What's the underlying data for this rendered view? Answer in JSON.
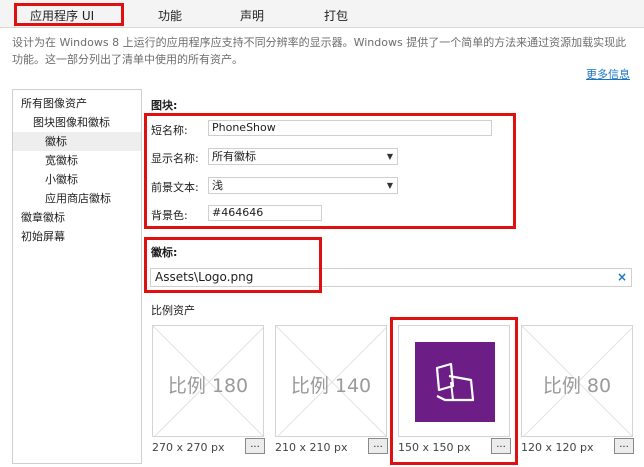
{
  "tabs": [
    {
      "label": "应用程序 UI"
    },
    {
      "label": "功能"
    },
    {
      "label": "声明"
    },
    {
      "label": "打包"
    }
  ],
  "description": "设计为在 Windows 8 上运行的应用程序应支持不同分辨率的显示器。Windows 提供了一个简单的方法来通过资源加载实现此功能。这一部分列出了清单中使用的所有资产。",
  "more_info": "更多信息",
  "nav": {
    "items": [
      {
        "label": "所有图像资产"
      },
      {
        "label": "图块图像和徽标"
      },
      {
        "label": "徽标"
      },
      {
        "label": "宽徽标"
      },
      {
        "label": "小徽标"
      },
      {
        "label": "应用商店徽标"
      },
      {
        "label": "徽章徽标"
      },
      {
        "label": "初始屏幕"
      }
    ],
    "selected": "徽标"
  },
  "tile": {
    "heading": "图块:",
    "short_name_label": "短名称:",
    "short_name_value": "PhoneShow",
    "display_name_label": "显示名称:",
    "display_name_value": "所有徽标",
    "foreground_label": "前景文本:",
    "foreground_value": "浅",
    "background_label": "背景色:",
    "background_value": "#464646"
  },
  "logo": {
    "heading": "徽标:",
    "path": "Assets\\Logo.png",
    "clear_icon": "×"
  },
  "scaled": {
    "heading": "比例资产",
    "items": [
      {
        "label": "比例 180",
        "size": "270 x 270 px"
      },
      {
        "label": "比例 140",
        "size": "210 x 210 px"
      },
      {
        "label": "",
        "size": "150 x 150 px"
      },
      {
        "label": "比例 80",
        "size": "120 x 120 px"
      }
    ],
    "browse_label": "...",
    "tile_color": "#6c1e86"
  },
  "colors": {
    "highlight": "#e01010",
    "link": "#1a73c6"
  }
}
